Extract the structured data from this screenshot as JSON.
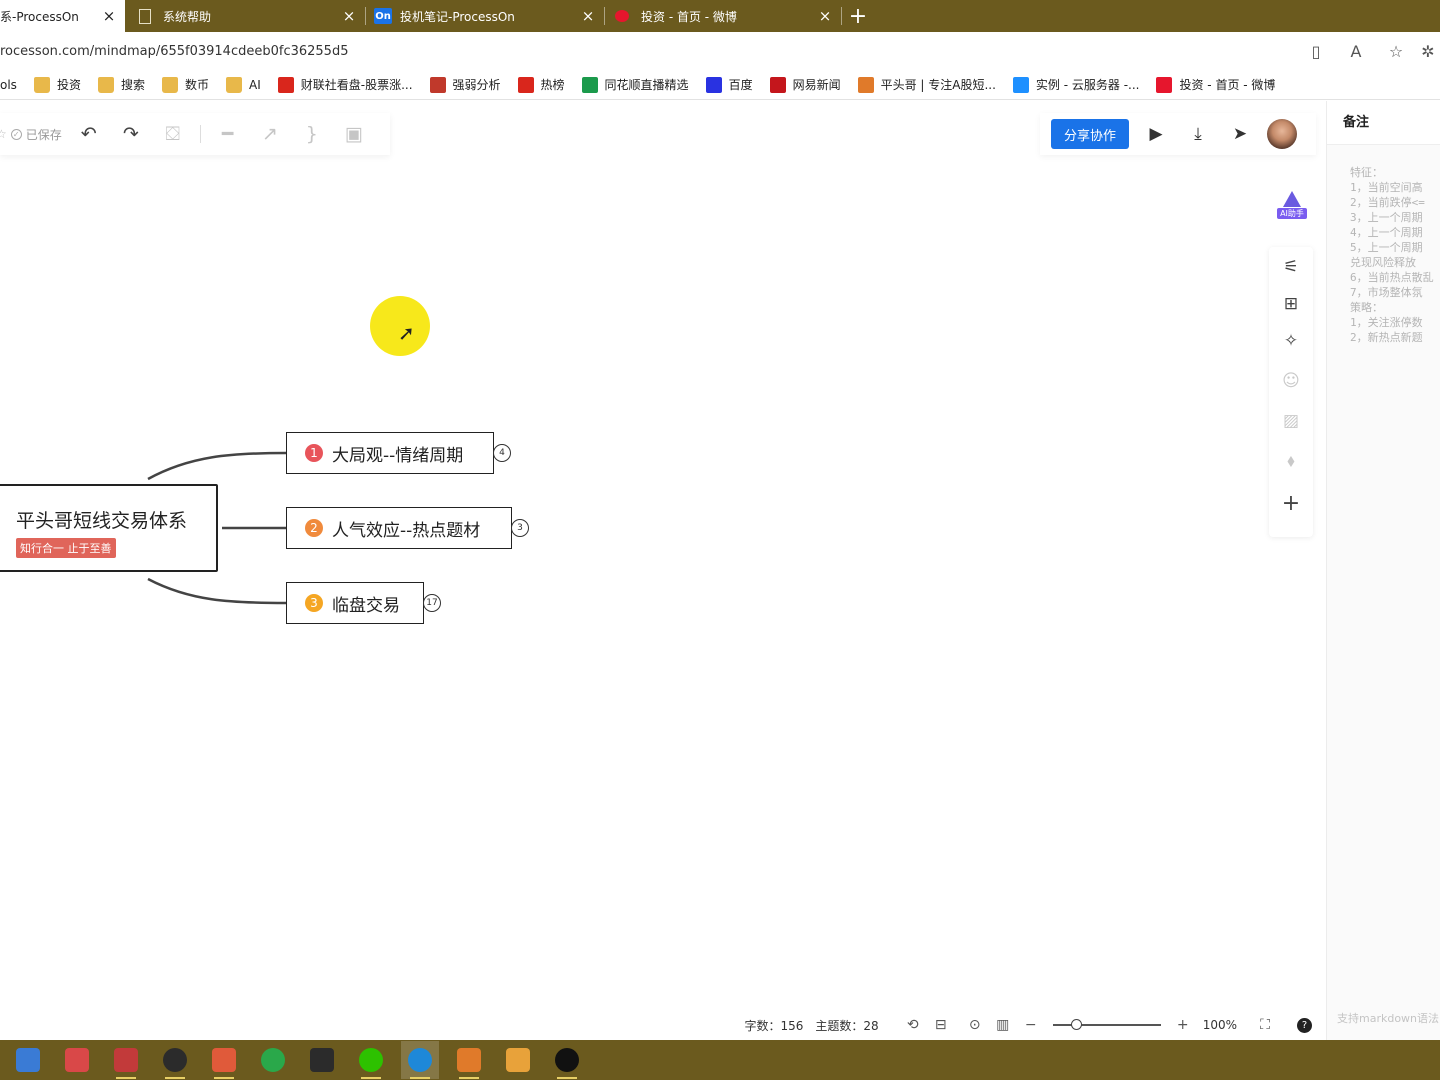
{
  "browser": {
    "tabs": [
      {
        "title": "系-ProcessOn",
        "icon": "processon-icon",
        "active": true
      },
      {
        "title": "系统帮助",
        "icon": "document-icon",
        "active": false
      },
      {
        "title": "投机笔记-ProcessOn",
        "icon": "processon-icon",
        "active": false
      },
      {
        "title": "投资 - 首页 - 微博",
        "icon": "weibo-icon",
        "active": false
      }
    ],
    "processon_badge": "On",
    "url": "rocesson.com/mindmap/655f03914cdeeb0fc36255d5",
    "bookmarks": [
      {
        "label": "ols",
        "icon": "none"
      },
      {
        "label": "投资",
        "icon": "folder-icon"
      },
      {
        "label": "搜索",
        "icon": "folder-icon"
      },
      {
        "label": "数币",
        "icon": "folder-icon"
      },
      {
        "label": "AI",
        "icon": "folder-icon"
      },
      {
        "label": "财联社看盘-股票涨...",
        "icon": "cls-icon"
      },
      {
        "label": "强弱分析",
        "icon": "chart-icon"
      },
      {
        "label": "热榜",
        "icon": "hot-icon"
      },
      {
        "label": "同花顺直播精选",
        "icon": "ths-icon"
      },
      {
        "label": "百度",
        "icon": "baidu-icon"
      },
      {
        "label": "网易新闻",
        "icon": "netease-icon"
      },
      {
        "label": "平头哥 | 专注A股短...",
        "icon": "badger-icon"
      },
      {
        "label": "实例 - 云服务器 -...",
        "icon": "cloud-icon"
      },
      {
        "label": "投资 - 首页 - 微博",
        "icon": "weibo-icon"
      }
    ]
  },
  "toolbar": {
    "saved_label": "已保存"
  },
  "top_right": {
    "share_label": "分享协作"
  },
  "ai": {
    "label": "AI助手"
  },
  "notes": {
    "title": "备注",
    "lines": [
      "特征：",
      "1，当前空间高",
      "2，当前跌停<=",
      "3，上一个周期",
      "4，上一个周期",
      "5，上一个周期",
      "兑现风险释放",
      "6，当前热点散乱",
      "7，市场整体氛",
      "策略：",
      "1，关注涨停数",
      "2，新热点新题"
    ],
    "footer": "支持markdown语法"
  },
  "mindmap": {
    "root_title": "平头哥短线交易体系",
    "root_tag": "知行合一 止于至善",
    "topics": [
      {
        "num": "1",
        "label": "大局观--情绪周期",
        "count": "4",
        "color": "#e8545a"
      },
      {
        "num": "2",
        "label": "人气效应--热点题材",
        "count": "3",
        "color": "#f08a3c"
      },
      {
        "num": "3",
        "label": "临盘交易",
        "count": "17",
        "color": "#f5a623"
      }
    ]
  },
  "status": {
    "words_label": "字数：",
    "words": "156",
    "topics_label": "主题数：",
    "topics": "28",
    "zoom": "100%",
    "zoom_level": 0.22,
    "help": "?"
  }
}
